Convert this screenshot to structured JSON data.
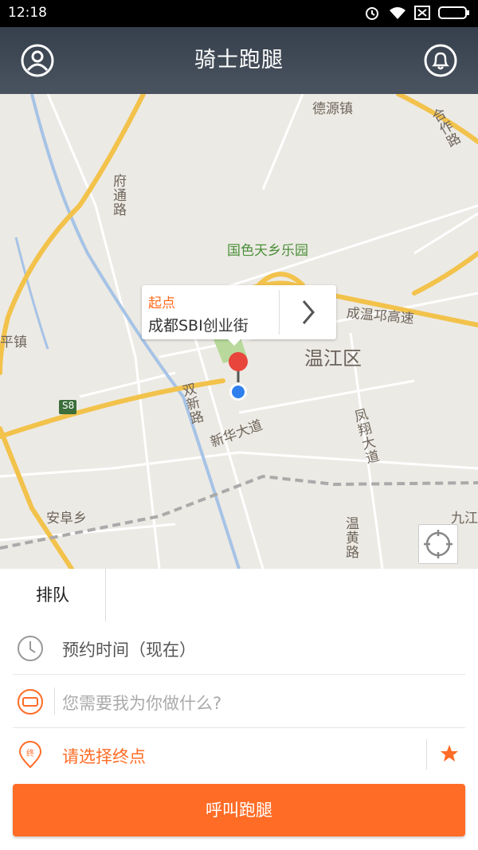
{
  "status_bar": {
    "time": "12:18"
  },
  "header": {
    "title": "骑士跑腿"
  },
  "map": {
    "labels": {
      "deyuan": "德源镇",
      "hezuo": "合作路",
      "futong": "府通路",
      "park": "国色天乡乐园",
      "expressway": "成温邛高速",
      "district": "温江区",
      "pingzhen": "平镇",
      "shuangxin": "双新路",
      "xinhua": "新华大道",
      "fengxiang": "凤翔大道",
      "s8": "S8",
      "anfu": "安阜乡",
      "wenhuang": "温黄路",
      "jiujiang": "九江"
    },
    "callout": {
      "tag": "起点",
      "address": "成都SBI创业街"
    }
  },
  "tabs": {
    "active": "排队"
  },
  "form": {
    "time_label": "预约时间（现在）",
    "task_placeholder": "您需要我为你做什么?",
    "destination_label": "请选择终点",
    "icon_text": "终"
  },
  "actions": {
    "call_label": "呼叫跑腿"
  },
  "colors": {
    "accent": "#ff6c26",
    "header": "#3c4653",
    "pin": "#e8453c",
    "location": "#2f80ed"
  }
}
